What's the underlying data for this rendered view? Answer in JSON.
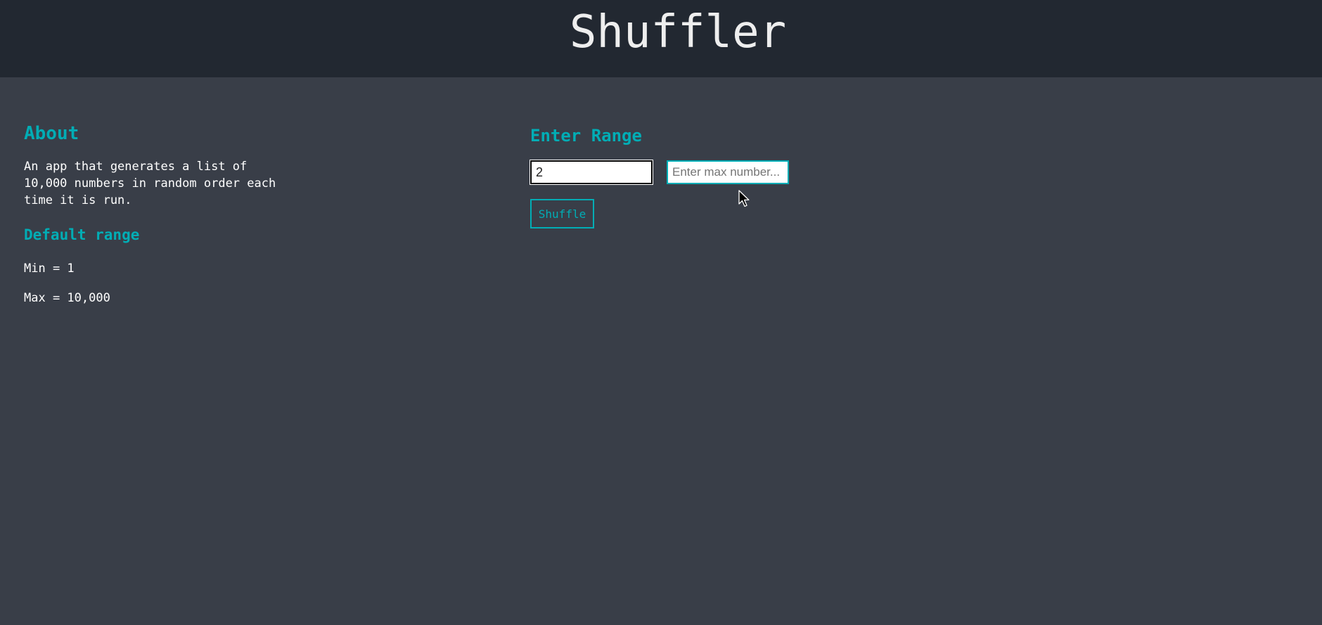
{
  "header": {
    "title": "Shuffler"
  },
  "about": {
    "heading": "About",
    "description": "An app that generates a list of 10,000 numbers in random order each time it is run.",
    "default_heading": "Default range",
    "min_text": "Min = 1",
    "max_text": "Max = 10,000"
  },
  "range": {
    "heading": "Enter Range",
    "min_value": "2",
    "max_placeholder": "Enter max number...",
    "max_value": "",
    "shuffle_label": "Shuffle"
  },
  "colors": {
    "header_bg": "#222831",
    "page_bg": "#393e48",
    "accent": "#00adb5",
    "text": "#ffffff"
  },
  "icons": {
    "cursor": "mouse-pointer-icon"
  }
}
